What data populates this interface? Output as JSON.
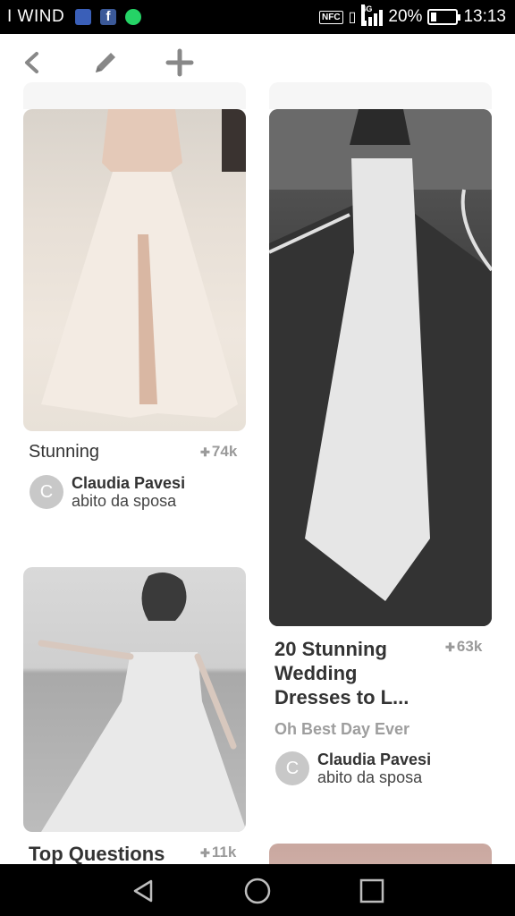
{
  "status_bar": {
    "carrier": "I WIND",
    "nfc_label": "NFC",
    "network_type": "4G",
    "battery_percent": "20%",
    "battery_level": 0.2,
    "time": "13:13",
    "fb_letter": "f",
    "icons": [
      "messenger-icon",
      "facebook-icon",
      "whatsapp-icon",
      "nfc-icon",
      "vibrate-icon",
      "signal-icon",
      "battery-icon"
    ]
  },
  "toolbar": {
    "icons": [
      "back-icon",
      "edit-icon",
      "add-icon"
    ]
  },
  "pins": [
    {
      "title": "Stunning",
      "count": "74k",
      "avatar_letter": "C",
      "user": "Claudia Pavesi",
      "board": "abito da sposa"
    },
    {
      "title_lines": [
        "20 Stunning",
        "Wedding",
        "Dresses to L..."
      ],
      "count": "63k",
      "source": "Oh Best Day Ever",
      "avatar_letter": "C",
      "user": "Claudia Pavesi",
      "board": "abito da sposa"
    },
    {
      "title": "Top Questions",
      "count": "11k"
    }
  ],
  "nav_bar": {
    "icons": [
      "back-triangle-icon",
      "home-circle-icon",
      "recents-square-icon"
    ]
  }
}
